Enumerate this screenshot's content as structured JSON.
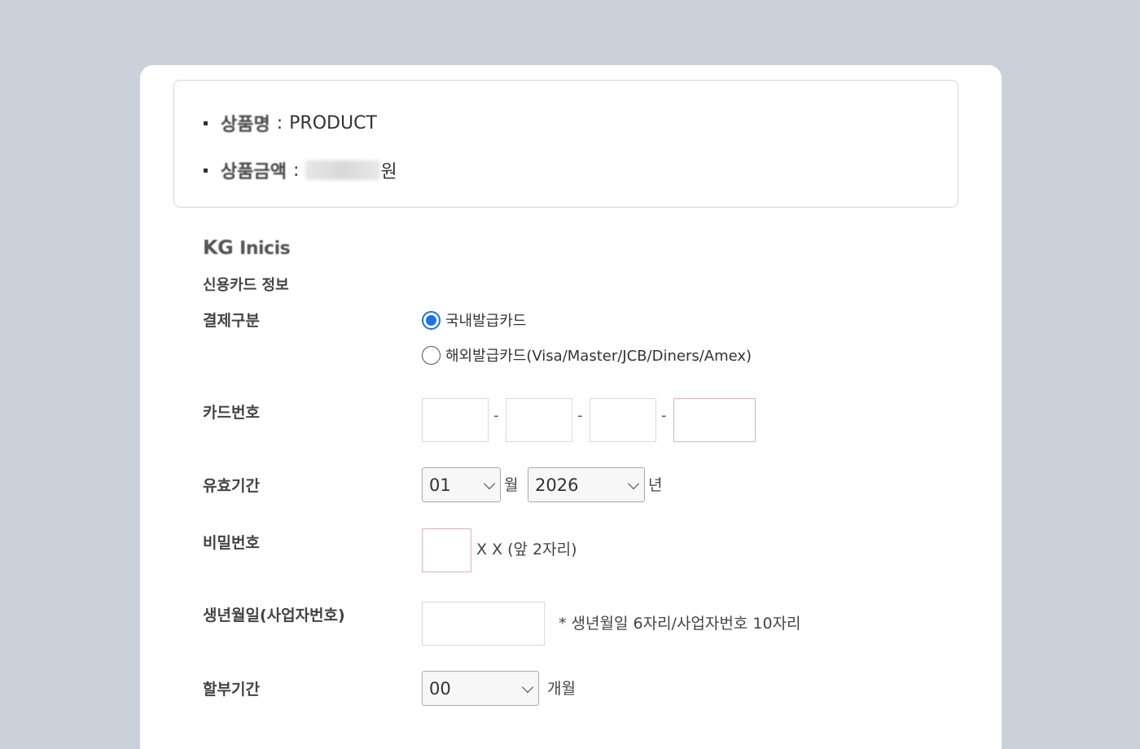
{
  "product": {
    "name_label": "상품명",
    "name_value": "PRODUCT",
    "price_label": "상품금액",
    "price_unit": "원",
    "separator": ":"
  },
  "brand": {
    "logo_kg": "KG",
    "logo_inicis": "Inicis"
  },
  "form": {
    "section_title": "신용카드 정보",
    "payment_type": {
      "label": "결제구분",
      "options": [
        "국내발급카드",
        "해외발급카드(Visa/Master/JCB/Diners/Amex)"
      ],
      "selected_index": 0
    },
    "card_number": {
      "label": "카드번호",
      "separator": "-"
    },
    "expiry": {
      "label": "유효기간",
      "month_value": "01",
      "month_unit": "월",
      "year_value": "2026",
      "year_unit": "년"
    },
    "password": {
      "label": "비밀번호",
      "hint": "X X (앞 2자리)"
    },
    "birth": {
      "label": "생년월일(사업자번호)",
      "hint": "* 생년월일 6자리/사업자번호 10자리"
    },
    "installment": {
      "label": "할부기간",
      "value": "00",
      "unit": "개월"
    }
  },
  "colors": {
    "background": "#cbd1db",
    "accent": "#1a73e8",
    "error_border": "#e6b3b3"
  }
}
